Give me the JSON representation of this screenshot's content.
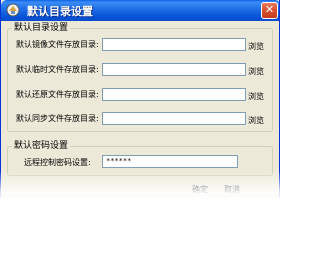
{
  "window": {
    "title": "默认目录设置",
    "close_glyph": "✕"
  },
  "dir_group": {
    "title": "默认目录设置",
    "rows": [
      {
        "label": "默认镜像文件存放目录:",
        "value": "",
        "browse": "浏览"
      },
      {
        "label": "默认临时文件存放目录:",
        "value": "",
        "browse": "浏览"
      },
      {
        "label": "默认还原文件存放目录:",
        "value": "",
        "browse": "浏览"
      },
      {
        "label": "默认同步文件存放目录:",
        "value": "",
        "browse": "浏览"
      }
    ]
  },
  "password_group": {
    "title": "默认密码设置",
    "label": "远程控制密码设置:",
    "value": "******"
  },
  "buttons": {
    "ok": "确定",
    "cancel": "取消"
  },
  "colors": {
    "titlebar": "#0a5fe8",
    "dialog_bg": "#ece9d8",
    "input_border": "#7f9db9",
    "close_button": "#d9512f"
  },
  "icons": {
    "app": "app-icon",
    "close": "close-icon"
  }
}
